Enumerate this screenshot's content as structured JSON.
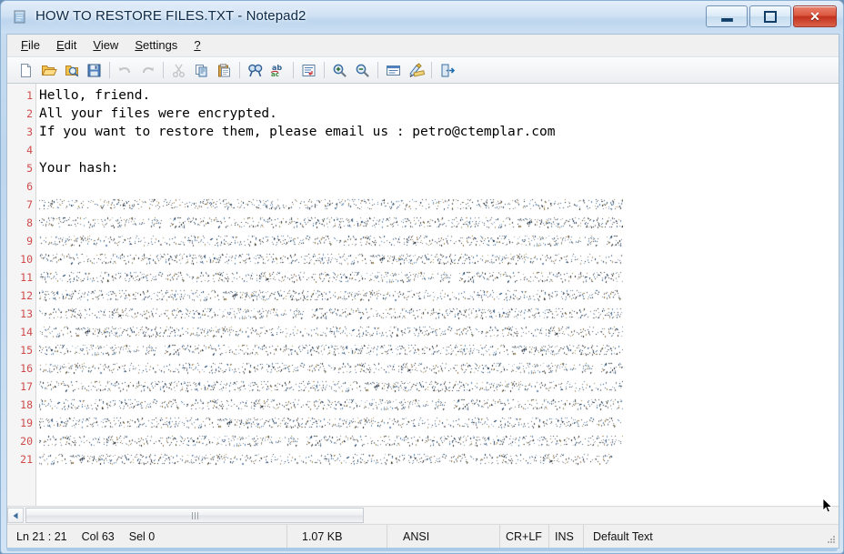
{
  "window": {
    "title": "HOW TO RESTORE FILES.TXT - Notepad2",
    "icon": "notepad-document-icon",
    "controls": {
      "minimize_label": "–",
      "maximize_label": "□",
      "close_label": "✕"
    },
    "colors": {
      "glass": "#c6dbf1",
      "frame_border": "#8ab0d4",
      "close_button": "#c3311d",
      "line_number": "#d04a4a",
      "client_bg": "#f0f0f0",
      "editor_bg": "#ffffff"
    }
  },
  "menubar": {
    "items": [
      {
        "label": "File",
        "accel": "F"
      },
      {
        "label": "Edit",
        "accel": "E"
      },
      {
        "label": "View",
        "accel": "V"
      },
      {
        "label": "Settings",
        "accel": "S"
      },
      {
        "label": "?",
        "accel": "?"
      }
    ]
  },
  "toolbar": {
    "buttons": [
      {
        "name": "new-file-icon",
        "tooltip": "New",
        "enabled": true
      },
      {
        "name": "open-file-icon",
        "tooltip": "Open",
        "enabled": true
      },
      {
        "name": "browse-file-icon",
        "tooltip": "Browse",
        "enabled": true
      },
      {
        "name": "save-file-icon",
        "tooltip": "Save",
        "enabled": true
      },
      {
        "name": "undo-icon",
        "tooltip": "Undo",
        "enabled": false
      },
      {
        "name": "redo-icon",
        "tooltip": "Redo",
        "enabled": false
      },
      {
        "name": "cut-icon",
        "tooltip": "Cut",
        "enabled": false
      },
      {
        "name": "copy-icon",
        "tooltip": "Copy",
        "enabled": true
      },
      {
        "name": "paste-icon",
        "tooltip": "Paste",
        "enabled": true
      },
      {
        "name": "find-icon",
        "tooltip": "Find",
        "enabled": true
      },
      {
        "name": "replace-icon",
        "tooltip": "Replace",
        "enabled": true
      },
      {
        "name": "word-wrap-icon",
        "tooltip": "Word Wrap",
        "enabled": true
      },
      {
        "name": "zoom-in-icon",
        "tooltip": "Zoom In",
        "enabled": true
      },
      {
        "name": "zoom-out-icon",
        "tooltip": "Zoom Out",
        "enabled": true
      },
      {
        "name": "show-whitespace-icon",
        "tooltip": "Show Whitespace",
        "enabled": true
      },
      {
        "name": "scheme-icon",
        "tooltip": "Scheme",
        "enabled": true
      },
      {
        "name": "exit-icon",
        "tooltip": "Exit",
        "enabled": true
      }
    ]
  },
  "editor": {
    "line_numbers": [
      1,
      2,
      3,
      4,
      5,
      6,
      7,
      8,
      9,
      10,
      11,
      12,
      13,
      14,
      15,
      16,
      17,
      18,
      19,
      20,
      21
    ],
    "lines": [
      {
        "n": 1,
        "type": "text",
        "text": "Hello, friend."
      },
      {
        "n": 2,
        "type": "text",
        "text": "All your files were encrypted."
      },
      {
        "n": 3,
        "type": "text",
        "text": "If you want to restore them, please email us : petro@ctemplar.com"
      },
      {
        "n": 4,
        "type": "text",
        "text": ""
      },
      {
        "n": 5,
        "type": "text",
        "text": "Your hash:"
      },
      {
        "n": 6,
        "type": "text",
        "text": ""
      },
      {
        "n": 7,
        "type": "hash",
        "text": ""
      },
      {
        "n": 8,
        "type": "hash",
        "text": ""
      },
      {
        "n": 9,
        "type": "hash",
        "text": ""
      },
      {
        "n": 10,
        "type": "hash",
        "text": ""
      },
      {
        "n": 11,
        "type": "hash",
        "text": ""
      },
      {
        "n": 12,
        "type": "hash",
        "text": ""
      },
      {
        "n": 13,
        "type": "hash",
        "text": ""
      },
      {
        "n": 14,
        "type": "hash",
        "text": ""
      },
      {
        "n": 15,
        "type": "hash",
        "text": ""
      },
      {
        "n": 16,
        "type": "hash",
        "text": ""
      },
      {
        "n": 17,
        "type": "hash",
        "text": ""
      },
      {
        "n": 18,
        "type": "hash",
        "text": ""
      },
      {
        "n": 19,
        "type": "hash",
        "text": ""
      },
      {
        "n": 20,
        "type": "hash",
        "text": ""
      },
      {
        "n": 21,
        "type": "hash",
        "text": ""
      }
    ],
    "hash_note": "unreadable dense encoded hash blob rendered at sub-pixel size"
  },
  "scrollbar": {
    "left_arrow": "◄",
    "thumb_grip": "grip-icon"
  },
  "statusbar": {
    "line": "Ln 21 : 21",
    "column": "Col 63",
    "selection": "Sel 0",
    "filesize": "1.07 KB",
    "encoding": "ANSI",
    "eol": "CR+LF",
    "insert_mode": "INS",
    "scheme": "Default Text"
  }
}
